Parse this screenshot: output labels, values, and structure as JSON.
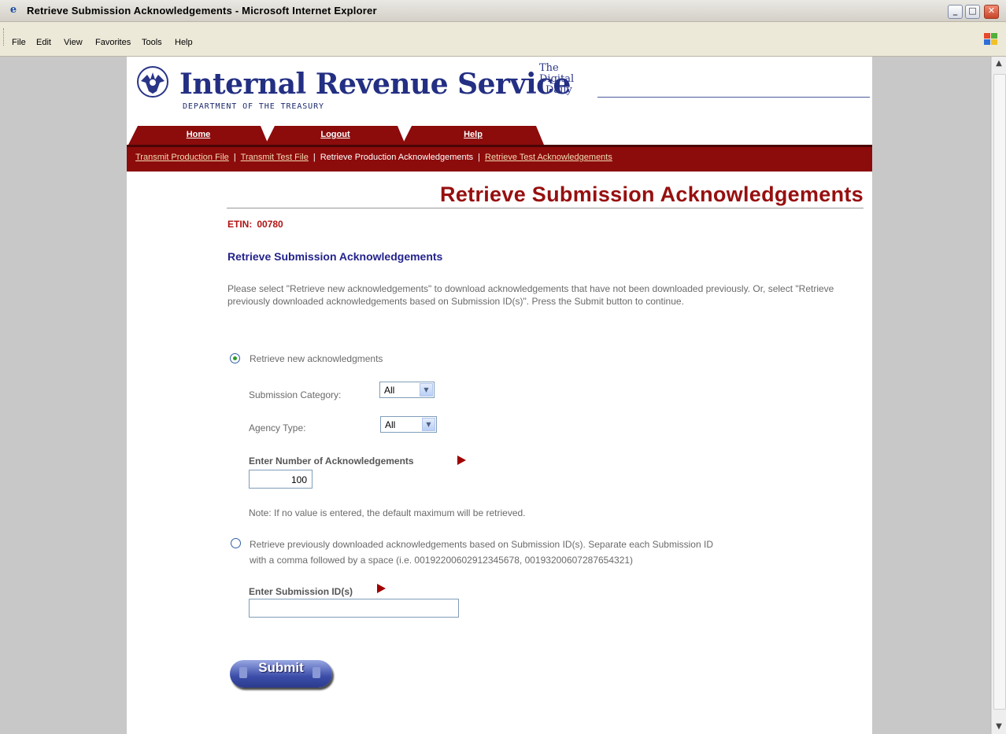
{
  "window": {
    "title": "Retrieve Submission Acknowledgements - Microsoft Internet Explorer",
    "ie_icon_glyph": "e",
    "minimize_glyph": "_",
    "maximize_glyph": "□",
    "close_glyph": "✕"
  },
  "menubar": {
    "items": [
      "File",
      "Edit",
      "View",
      "Favorites",
      "Tools",
      "Help"
    ]
  },
  "header": {
    "agency_name": "Internal Revenue Service",
    "department": "DEPARTMENT OF THE TREASURY",
    "tagline_lines": [
      "The",
      "Digital",
      "Daily"
    ]
  },
  "tabs": [
    {
      "label": "Home"
    },
    {
      "label": "Logout"
    },
    {
      "label": "Help"
    }
  ],
  "subnav": {
    "items": [
      {
        "label": "Transmit Production File",
        "current": false
      },
      {
        "label": "Transmit Test File",
        "current": false
      },
      {
        "label": "Retrieve Production Acknowledgements",
        "current": true
      },
      {
        "label": "Retrieve Test Acknowledgements",
        "current": false
      }
    ],
    "separator": "|"
  },
  "main": {
    "page_title": "Retrieve Submission Acknowledgements",
    "etin_label": "ETIN:",
    "etin_value": "00780",
    "section_heading": "Retrieve Submission Acknowledgements",
    "instructions": "Please select \"Retrieve new acknowledgements\" to download acknowledgements that have not been downloaded previously. Or, select \"Retrieve previously downloaded acknowledgements based on Submission ID(s)\". Press the Submit button to continue.",
    "option_new": {
      "label": "Retrieve new acknowledgments",
      "selected": true,
      "submission_category_label": "Submission Category:",
      "submission_category_value": "All",
      "agency_type_label": "Agency Type:",
      "agency_type_value": "All",
      "number_label": "Enter Number of Acknowledgements",
      "number_value": "100",
      "note": "Note: If no value is entered, the default maximum will be retrieved."
    },
    "option_previous": {
      "label_line1": "Retrieve previously downloaded acknowledgements based on Submission ID(s). Separate each Submission ID",
      "label_line2": "with a comma followed by a space (i.e. 00192200602912345678, 00193200607287654321)",
      "selected": false,
      "ids_label": "Enter Submission ID(s)",
      "ids_value": ""
    },
    "submit_label": "Submit"
  },
  "colors": {
    "brand_red": "#8c0b0b",
    "title_red": "#970f0f",
    "navy": "#232f83",
    "link_cream": "#f3dcb3"
  }
}
